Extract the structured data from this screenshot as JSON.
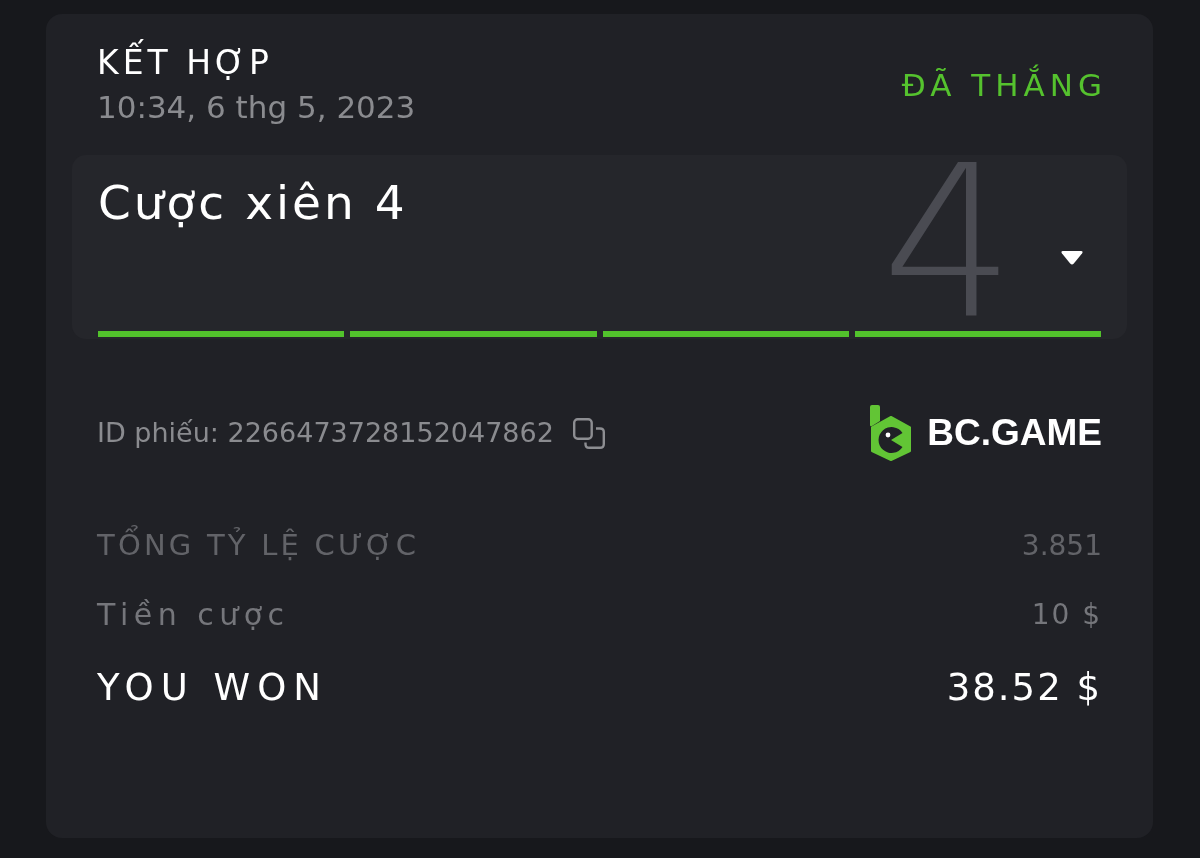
{
  "bet": {
    "type": "KẾT HỢP",
    "time": "10:34, 6 thg 5, 2023",
    "status": {
      "label": "ĐÃ THẮNG",
      "kind": "won"
    }
  },
  "parlay": {
    "title": "Cược xiên 4",
    "leg_count": "4",
    "expanded": false,
    "legs": [
      {
        "won": true
      },
      {
        "won": true
      },
      {
        "won": true
      },
      {
        "won": true
      }
    ]
  },
  "ticket": {
    "id_text": "ID phiếu: 2266473728152047862"
  },
  "brand": {
    "name": "BC.GAME"
  },
  "summary": [
    {
      "kind": "odds",
      "label": "TỔNG TỶ LỆ CƯỢC",
      "value": "3.851"
    },
    {
      "kind": "stake",
      "label": "Tiền cược",
      "value": "10 $"
    },
    {
      "kind": "payout",
      "label": "YOU WON",
      "value": "38.52 $"
    }
  ]
}
